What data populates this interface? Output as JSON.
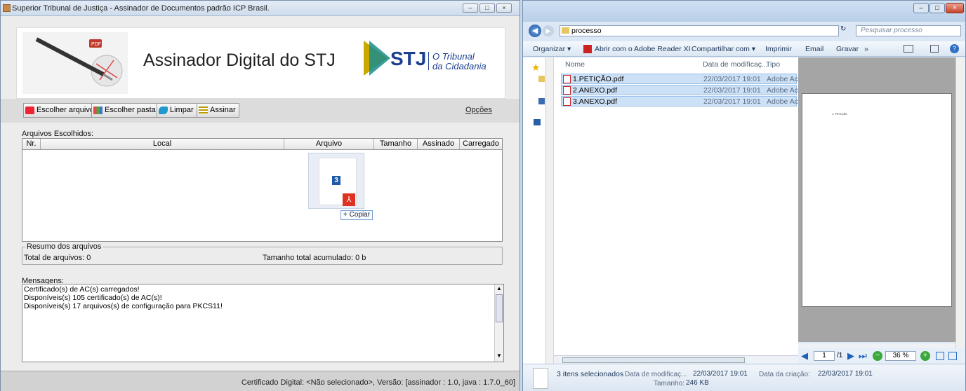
{
  "java_window": {
    "title": "Superior Tribunal de Justiça - Assinador de Documentos padrão ICP Brasil.",
    "banner_title": "Assinador Digital do STJ",
    "logo_text": "STJ",
    "logo_tagline_1": "O Tribunal",
    "logo_tagline_2": "da Cidadania",
    "toolbar": {
      "choose_file": "Escolher arquivo",
      "choose_folder": "Escolher pasta",
      "clear": "Limpar",
      "sign": "Assinar",
      "options": "Opções"
    },
    "files_label": "Arquivos Escolhidos:",
    "columns": [
      "Nr.",
      "Local",
      "Arquivo",
      "Tamanho",
      "Assinado",
      "Carregado"
    ],
    "drag_badge": "3",
    "copy_tooltip": "+ Copiar",
    "summary": {
      "legend": "Resumo dos arquivos",
      "total_files": "Total de arquivos: 0",
      "total_size": "Tamanho total acumulado: 0 b"
    },
    "messages_label": "Mensagens:",
    "messages": [
      "Certificado(s) de AC(s) carregados!",
      "Disponíveis(s) 105 certificado(s) de AC(s)!",
      "Disponíveis(s) 17 arquivos(s) de configuração para PKCS11!"
    ],
    "status": "Certificado Digital: <Não selecionado>,  Versão: [assinador : 1.0, java : 1.7.0_60]"
  },
  "explorer": {
    "address": "processo",
    "search_placeholder": "Pesquisar processo",
    "commands": [
      "Organizar ▾",
      "Abrir com o Adobe Reader XI",
      "Compartilhar com ▾",
      "Imprimir",
      "Email",
      "Gravar",
      "»"
    ],
    "columns": [
      "Nome",
      "Data de modificaç...",
      "Tipo"
    ],
    "files": [
      {
        "name": "1.PETIÇÃO.pdf",
        "date": "22/03/2017 19:01",
        "type": "Adobe Acr"
      },
      {
        "name": "2.ANEXO.pdf",
        "date": "22/03/2017 19:01",
        "type": "Adobe Acr"
      },
      {
        "name": "3.ANEXO.pdf",
        "date": "22/03/2017 19:01",
        "type": "Adobe Acr"
      }
    ],
    "preview_text": "1. PETIÇÃO",
    "preview_page": "1",
    "preview_pages": "/1",
    "zoom": "36 %",
    "details": {
      "selected": "3 itens selecionados",
      "modified_label": "Data de modificaç...",
      "modified_value": "22/03/2017 19:01",
      "size_label": "Tamanho:",
      "size_value": "246 KB",
      "created_label": "Data da criação:",
      "created_value": "22/03/2017 19:01"
    }
  }
}
